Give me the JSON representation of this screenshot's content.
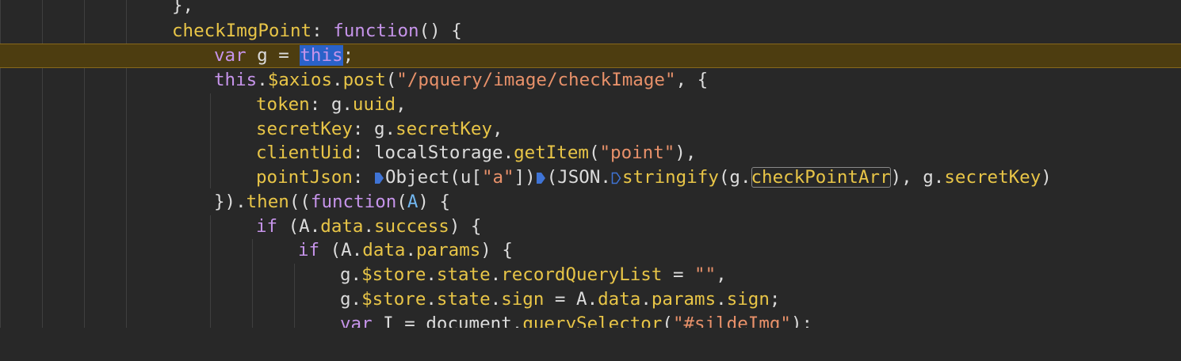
{
  "editor": {
    "colors": {
      "background": "#282828",
      "current_line": "#4d3d10",
      "keyword": "#c694ea",
      "function": "#e8c547",
      "string": "#e8916a",
      "plain": "#dcdcdc",
      "selection": "#2a62c9"
    },
    "lines": {
      "l0": {
        "t0": "},",
        "t1": ""
      },
      "l1": {
        "t0": "checkImgPoint",
        "t1": ": ",
        "t2": "function",
        "t3": "() {"
      },
      "l2": {
        "t0": "var",
        "t1": " g = ",
        "t2": "this",
        "t3": ";"
      },
      "l3": {
        "t0": "this",
        "t1": ".",
        "t2": "$axios",
        "t3": ".",
        "t4": "post",
        "t5": "(",
        "t6": "\"/pquery/image/checkImage\"",
        "t7": ", {"
      },
      "l4": {
        "t0": "token",
        "t1": ": g.",
        "t2": "uuid",
        "t3": ","
      },
      "l5": {
        "t0": "secretKey",
        "t1": ": g.",
        "t2": "secretKey",
        "t3": ","
      },
      "l6": {
        "t0": "clientUid",
        "t1": ": localStorage.",
        "t2": "getItem",
        "t3": "(",
        "t4": "\"point\"",
        "t5": "),"
      },
      "l7": {
        "t0": "pointJson",
        "t1": ": ",
        "t2": "Object(u[",
        "t3": "\"a\"",
        "t4": "])",
        "t5": "(JSON.",
        "t6": "stringify",
        "t7": "(g.",
        "t8": "checkPointArr",
        "t9": "), g.",
        "t10": "secretKey",
        "t11": ")"
      },
      "l8": {
        "t0": "}).",
        "t1": "then",
        "t2": "((",
        "t3": "function",
        "t4": "(",
        "t5": "A",
        "t6": ") {"
      },
      "l9": {
        "t0": "if",
        "t1": " (A.",
        "t2": "data",
        "t3": ".",
        "t4": "success",
        "t5": ") {"
      },
      "l10": {
        "t0": "if",
        "t1": " (A.",
        "t2": "data",
        "t3": ".",
        "t4": "params",
        "t5": ") {"
      },
      "l11": {
        "t0": "g.",
        "t1": "$store",
        "t2": ".",
        "t3": "state",
        "t4": ".",
        "t5": "recordQueryList",
        "t6": " = ",
        "t7": "\"\"",
        "t8": ","
      },
      "l12": {
        "t0": "g.",
        "t1": "$store",
        "t2": ".",
        "t3": "state",
        "t4": ".",
        "t5": "sign",
        "t6": " = A.",
        "t7": "data",
        "t8": ".",
        "t9": "params",
        "t10": ".",
        "t11": "sign",
        "t12": ";"
      },
      "l13": {
        "t0": "var",
        "t1": " I = document.",
        "t2": "querySelector",
        "t3": "(",
        "t4": "\"#sildeImg\"",
        "t5": ");"
      }
    }
  }
}
